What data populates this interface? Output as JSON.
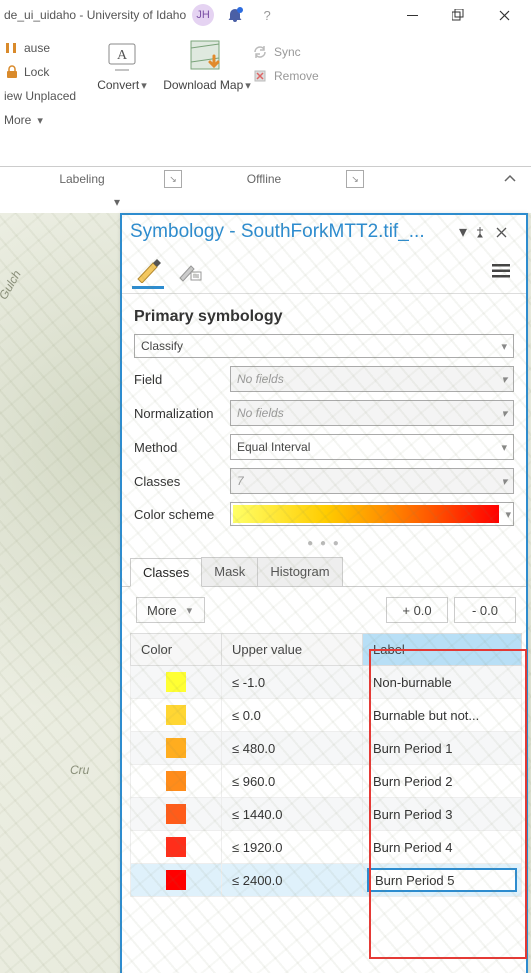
{
  "window": {
    "title": "de_ui_uidaho - University of Idaho",
    "user_initials": "JH"
  },
  "ribbon": {
    "pause": "ause",
    "lock": "Lock",
    "view_unplaced": "iew Unplaced",
    "more": "More",
    "convert": "Convert",
    "download": "Download Map",
    "sync": "Sync",
    "remove": "Remove",
    "group_labeling": "Labeling",
    "group_offline": "Offline"
  },
  "panel": {
    "title": "Symbology - SouthForkMTT2.tif_...",
    "section": "Primary symbology",
    "type_dd": "Classify",
    "field_label": "Field",
    "field_value": "No fields",
    "norm_label": "Normalization",
    "norm_value": "No fields",
    "method_label": "Method",
    "method_value": "Equal Interval",
    "classes_label": "Classes",
    "classes_value": "7",
    "scheme_label": "Color scheme",
    "tabs": {
      "classes": "Classes",
      "mask": "Mask",
      "histogram": "Histogram"
    },
    "more_btn": "More",
    "spin_plus": "+ 0.0",
    "spin_minus": "- 0.0",
    "table": {
      "head_color": "Color",
      "head_upper": "Upper value",
      "head_label": "Label",
      "rows": [
        {
          "color": "#ffff33",
          "upper": "≤   -1.0",
          "label": "Non-burnable"
        },
        {
          "color": "#ffd633",
          "upper": "≤   0.0",
          "label": "Burnable but not..."
        },
        {
          "color": "#ffad1f",
          "upper": "≤   480.0",
          "label": "Burn Period 1"
        },
        {
          "color": "#ff8c1a",
          "upper": "≤   960.0",
          "label": "Burn Period 2"
        },
        {
          "color": "#ff5c1a",
          "upper": "≤   1440.0",
          "label": "Burn Period 3"
        },
        {
          "color": "#ff2e1a",
          "upper": "≤   1920.0",
          "label": "Burn Period 4"
        },
        {
          "color": "#ff0000",
          "upper": "≤   2400.0",
          "label": "Burn Period 5"
        }
      ]
    }
  },
  "map": {
    "gulch": "Gulch",
    "cru": "Cru"
  }
}
